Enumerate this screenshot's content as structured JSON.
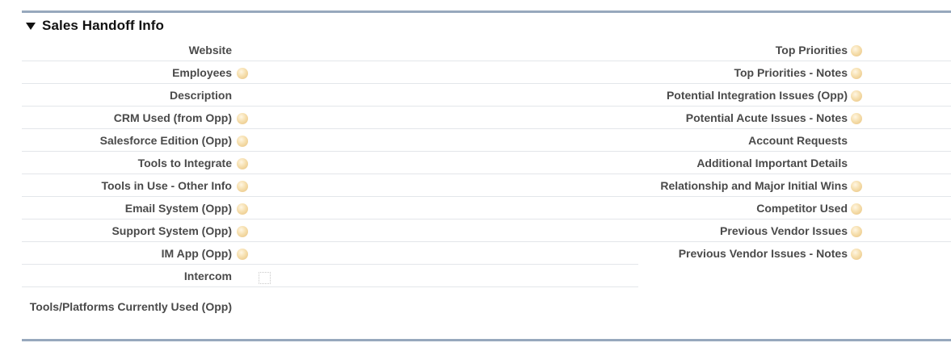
{
  "section": {
    "title": "Sales Handoff Info"
  },
  "left_fields": [
    {
      "label": "Website",
      "help": false
    },
    {
      "label": "Employees",
      "help": true
    },
    {
      "label": "Description",
      "help": false
    },
    {
      "label": "CRM Used (from Opp)",
      "help": true
    },
    {
      "label": "Salesforce Edition (Opp)",
      "help": true
    },
    {
      "label": "Tools to Integrate",
      "help": true
    },
    {
      "label": "Tools in Use - Other Info",
      "help": true
    },
    {
      "label": "Email System (Opp)",
      "help": true
    },
    {
      "label": "Support System (Opp)",
      "help": true
    },
    {
      "label": "IM App (Opp)",
      "help": true
    },
    {
      "label": "Intercom",
      "help": false,
      "checkbox": true,
      "checked": false
    },
    {
      "label": "Tools/Platforms Currently Used (Opp)",
      "help": false
    }
  ],
  "right_fields": [
    {
      "label": "Top Priorities",
      "help": true
    },
    {
      "label": "Top Priorities - Notes",
      "help": true
    },
    {
      "label": "Potential Integration Issues (Opp)",
      "help": true
    },
    {
      "label": "Potential Acute Issues - Notes",
      "help": true
    },
    {
      "label": "Account Requests",
      "help": false
    },
    {
      "label": "Additional Important Details",
      "help": false
    },
    {
      "label": "Relationship and Major Initial Wins",
      "help": true
    },
    {
      "label": "Competitor Used",
      "help": true
    },
    {
      "label": "Previous Vendor Issues",
      "help": true
    },
    {
      "label": "Previous Vendor Issues - Notes",
      "help": true
    }
  ],
  "colors": {
    "section_border": "#97a8bd",
    "row_divider": "#e3e6ea",
    "label": "#4a4a4a",
    "help_icon": "#f6dfae"
  },
  "icons": {
    "twisty": "triangle-down-icon",
    "help": "help-bubble-icon"
  }
}
